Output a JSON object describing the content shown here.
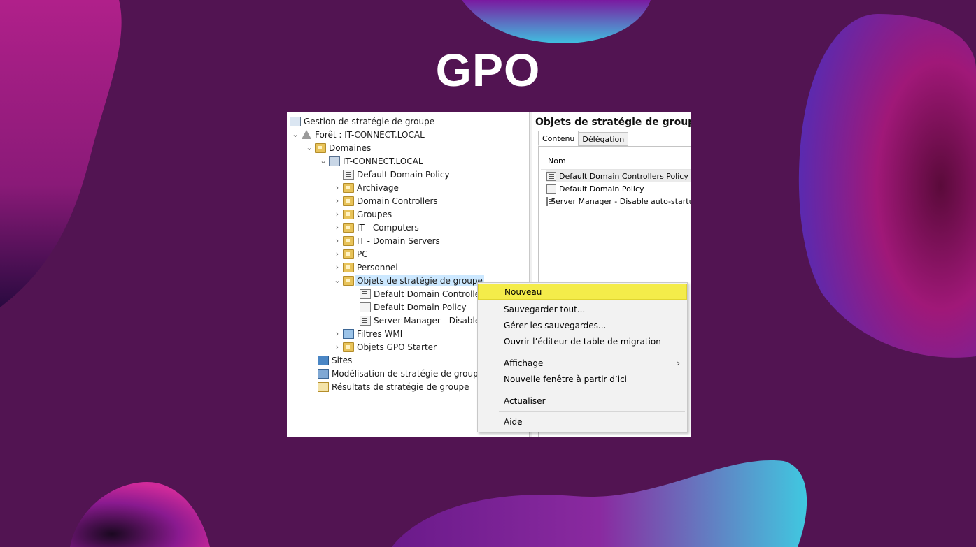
{
  "page_title": "GPO",
  "colors": {
    "background": "#521452",
    "menu_highlight": "#f4ec4a",
    "selection": "#cce8ff"
  },
  "tree": {
    "root": "Gestion de stratégie de groupe",
    "forest": "Forêt : IT-CONNECT.LOCAL",
    "domains": "Domaines",
    "domain": "IT-CONNECT.LOCAL",
    "default_policy": "Default Domain Policy",
    "ous": [
      "Archivage",
      "Domain Controllers",
      "Groupes",
      "IT - Computers",
      "IT - Domain Servers",
      "PC",
      "Personnel"
    ],
    "gpo_container": "Objets de stratégie de groupe",
    "gpo_children": [
      "Default Domain Controllers Policy",
      "Default Domain Policy",
      "Server Manager - Disable auto-startup"
    ],
    "wmi_filters": "Filtres WMI",
    "starter_gpos": "Objets GPO Starter",
    "sites": "Sites",
    "modeling": "Modélisation de stratégie de groupe",
    "results": "Résultats de stratégie de groupe"
  },
  "right_pane": {
    "title": "Objets de stratégie de groupe",
    "tabs": [
      "Contenu",
      "Délégation"
    ],
    "column_header": "Nom",
    "rows": [
      "Default Domain Controllers Policy",
      "Default Domain Policy",
      "Server Manager - Disable auto-startup"
    ]
  },
  "context_menu": {
    "items": [
      {
        "label": "Nouveau",
        "highlighted": true
      },
      {
        "label": "Sauvegarder tout..."
      },
      {
        "label": "Gérer les sauvegardes..."
      },
      {
        "label": "Ouvrir l’éditeur de table de migration"
      },
      {
        "label": "Affichage",
        "submenu_arrow": "›"
      },
      {
        "label": "Nouvelle fenêtre à partir d’ici"
      },
      {
        "label": "Actualiser"
      },
      {
        "label": "Aide"
      }
    ]
  }
}
